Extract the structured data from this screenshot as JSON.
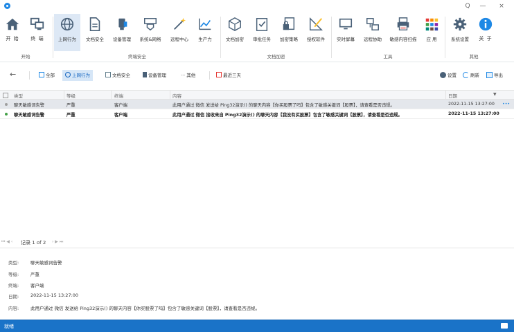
{
  "window": {
    "minimize": "—",
    "close": "×",
    "search": "Q"
  },
  "ribbon": {
    "start": {
      "label": "开始",
      "buttons": [
        "开 始",
        "终 端"
      ]
    },
    "terminal_security": {
      "label": "终端安全",
      "buttons": [
        "上网行为",
        "文档安全",
        "设备管理",
        "系统&网络",
        "远程中心",
        "生产力"
      ]
    },
    "doc_encryption": {
      "label": "文档加密",
      "buttons": [
        "文档加密",
        "审批任务",
        "加密策略",
        "授权软件"
      ]
    },
    "tools": {
      "label": "工具",
      "buttons": [
        "实时屏幕",
        "远程协助",
        "敏感内容扫描",
        "应 用"
      ]
    },
    "other": {
      "label": "其他",
      "buttons": [
        "系统设置",
        "关 于"
      ]
    }
  },
  "filterbar": {
    "all": "全部",
    "web": "上网行为",
    "doc": "文档安全",
    "device": "设备管理",
    "more": "··· 其他",
    "date": "最近三天",
    "settings": "设置",
    "refresh": "刷新",
    "export": "导出"
  },
  "grid": {
    "headers": {
      "type": "类型",
      "level": "等级",
      "terminal": "终端",
      "content": "内容",
      "date": "日期"
    },
    "rows": [
      {
        "type": "聊天敏感词告警",
        "level": "严重",
        "terminal": "客户端",
        "content": "此用户通过 微信 发送给 Ping32演示() 的聊天内容【你买股票了吗】包含了敏感关键词【股票】，请查看是否违规。",
        "date": "2022-11-15 13:27:00",
        "more": "•••",
        "dot_color": "#9e9e9e"
      },
      {
        "type": "聊天敏感词告警",
        "level": "严重",
        "terminal": "客户端",
        "content": "此用户通过 微信 接收来自 Ping32演示() 的聊天内容【我没有买股票】包含了敏感关键词【股票】，请查看是否违规。",
        "date": "2022-11-15 13:27:00",
        "dot_color": "#43a047"
      }
    ]
  },
  "pager": {
    "nav_left": "⏮ ◀ ‹",
    "text": "记录 1 of 2",
    "nav_right": "› ▶ ⏭"
  },
  "detail": {
    "type_label": "类型:",
    "type_value": "聊天敏感词告警",
    "level_label": "等级:",
    "level_value": "严重",
    "terminal_label": "终端:",
    "terminal_value": "客户端",
    "date_label": "日期:",
    "date_value": "2022-11-15 13:27:00",
    "content_label": "内容:",
    "content_value": "此用户通过 微信 发送给 Ping32演示() 的聊天内容【你买股票了吗】包含了敏感关键词【股票】，请查看是否违规。"
  },
  "status": {
    "text": "就绪"
  },
  "colors": {
    "accent": "#1a73c8",
    "selected_row": "#e4e7ec",
    "active_tab": "#dde8f5"
  }
}
